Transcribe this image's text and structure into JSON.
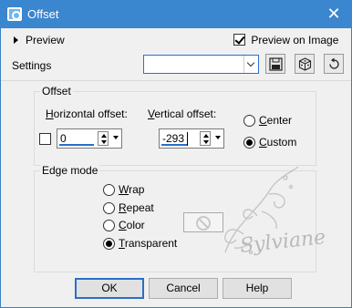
{
  "window": {
    "title": "Offset",
    "close_glyph": "✕"
  },
  "toolbar": {
    "preview_label": "Preview",
    "preview_on_image_label": "Preview on Image",
    "preview_on_image_checked": true,
    "settings_label": "Settings",
    "settings_value": "",
    "icons": [
      "save-icon",
      "dice-icon",
      "reset-icon"
    ]
  },
  "offset_group": {
    "title": "Offset",
    "horizontal": {
      "label_u": "H",
      "label_rest": "orizontal offset:",
      "value": "0"
    },
    "vertical": {
      "label_u": "V",
      "label_rest": "ertical offset:",
      "value": "-293"
    },
    "center_label_u": "C",
    "center_label_rest": "enter",
    "custom_label_u": "C",
    "custom_label_rest": "ustom",
    "selected": "custom",
    "link_checkbox_checked": false
  },
  "edge_group": {
    "title": "Edge mode",
    "options": [
      {
        "u": "W",
        "rest": "rap",
        "selected": false
      },
      {
        "u": "R",
        "rest": "epeat",
        "selected": false
      },
      {
        "u": "C",
        "rest": "olor",
        "selected": false
      },
      {
        "u": "T",
        "rest": "ransparent",
        "selected": true
      }
    ],
    "color_swatch_icon": "no-color-icon"
  },
  "watermark": {
    "text": "Sylviane"
  },
  "buttons": {
    "ok": "OK",
    "cancel": "Cancel",
    "help": "Help"
  }
}
